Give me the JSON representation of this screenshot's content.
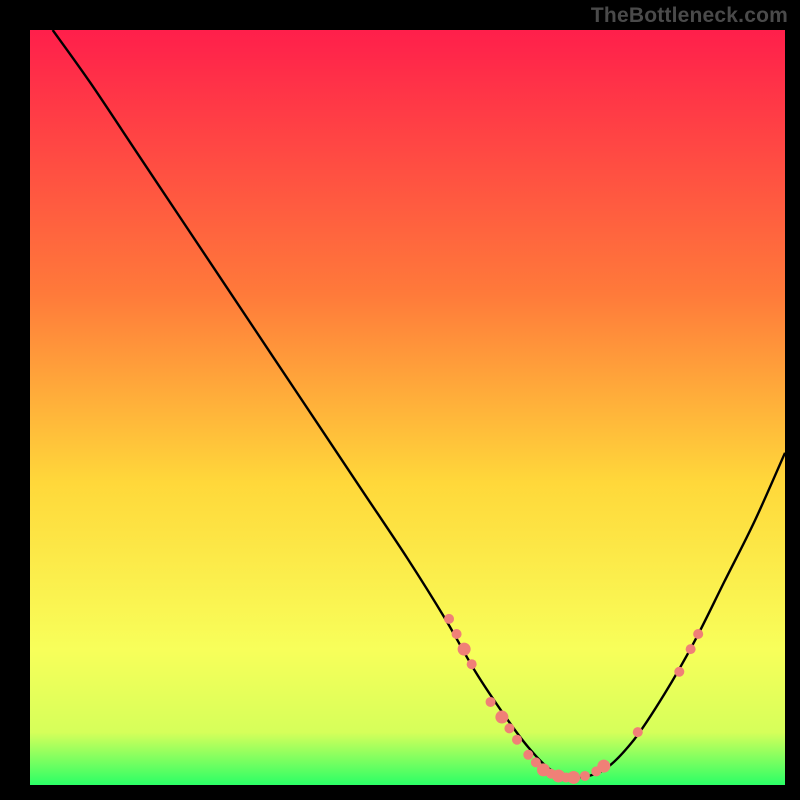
{
  "watermark": "TheBottleneck.com",
  "chart_data": {
    "type": "line",
    "title": "",
    "xlabel": "",
    "ylabel": "",
    "xlim": [
      0,
      100
    ],
    "ylim": [
      0,
      100
    ],
    "background_gradient": {
      "stops": [
        {
          "offset": 0,
          "color": "#ff1f4b"
        },
        {
          "offset": 35,
          "color": "#ff7a3a"
        },
        {
          "offset": 60,
          "color": "#ffd83a"
        },
        {
          "offset": 82,
          "color": "#f8ff5a"
        },
        {
          "offset": 93,
          "color": "#d6ff5a"
        },
        {
          "offset": 100,
          "color": "#2bff66"
        }
      ]
    },
    "series": [
      {
        "name": "bottleneck-curve",
        "color": "#000000",
        "x": [
          3,
          8,
          14,
          20,
          26,
          32,
          38,
          44,
          50,
          55,
          59,
          63,
          66,
          69,
          72,
          76,
          80,
          84,
          88,
          92,
          96,
          100
        ],
        "y": [
          100,
          93,
          84,
          75,
          66,
          57,
          48,
          39,
          30,
          22,
          15,
          9,
          5,
          2,
          1,
          2,
          6,
          12,
          19,
          27,
          35,
          44
        ]
      }
    ],
    "markers": {
      "color": "#f08077",
      "radius_small": 5,
      "radius_large": 6.5,
      "points": [
        {
          "x": 55.5,
          "y": 22,
          "r": "small"
        },
        {
          "x": 56.5,
          "y": 20,
          "r": "small"
        },
        {
          "x": 57.5,
          "y": 18,
          "r": "large"
        },
        {
          "x": 58.5,
          "y": 16,
          "r": "small"
        },
        {
          "x": 61,
          "y": 11,
          "r": "small"
        },
        {
          "x": 62.5,
          "y": 9,
          "r": "large"
        },
        {
          "x": 63.5,
          "y": 7.5,
          "r": "small"
        },
        {
          "x": 64.5,
          "y": 6,
          "r": "small"
        },
        {
          "x": 66,
          "y": 4,
          "r": "small"
        },
        {
          "x": 67,
          "y": 3,
          "r": "small"
        },
        {
          "x": 68,
          "y": 2,
          "r": "large"
        },
        {
          "x": 69,
          "y": 1.5,
          "r": "small"
        },
        {
          "x": 70,
          "y": 1.2,
          "r": "large"
        },
        {
          "x": 71,
          "y": 1,
          "r": "small"
        },
        {
          "x": 72,
          "y": 1,
          "r": "large"
        },
        {
          "x": 73.5,
          "y": 1.2,
          "r": "small"
        },
        {
          "x": 75,
          "y": 1.8,
          "r": "small"
        },
        {
          "x": 76,
          "y": 2.5,
          "r": "large"
        },
        {
          "x": 80.5,
          "y": 7,
          "r": "small"
        },
        {
          "x": 86,
          "y": 15,
          "r": "small"
        },
        {
          "x": 87.5,
          "y": 18,
          "r": "small"
        },
        {
          "x": 88.5,
          "y": 20,
          "r": "small"
        }
      ]
    }
  }
}
